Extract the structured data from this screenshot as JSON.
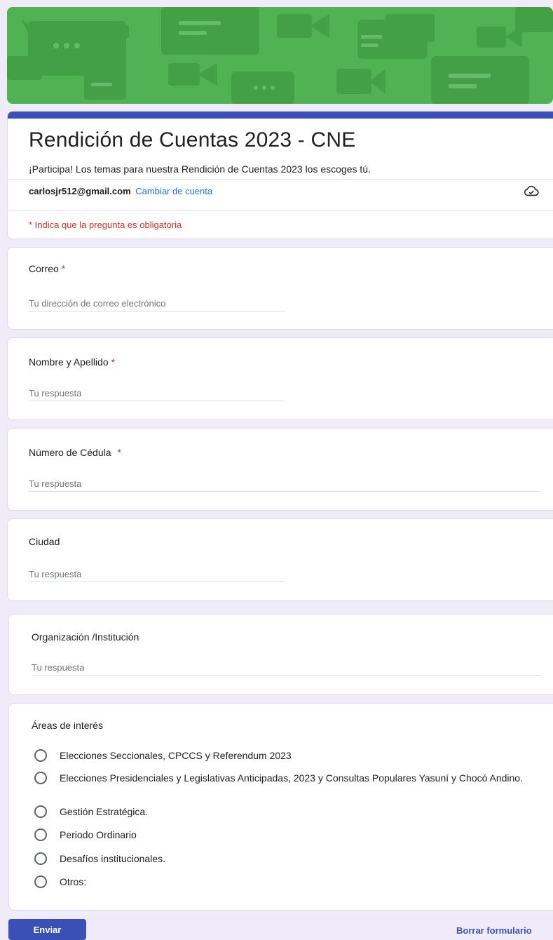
{
  "form": {
    "title": "Rendición de Cuentas 2023 - CNE",
    "description": "¡Participa! Los temas para nuestra Rendición de Cuentas 2023 los escoges tú.",
    "account_email": "carlosjr512@gmail.com",
    "switch_account": "Cambiar de cuenta",
    "required_note": "* Indica que la pregunta es obligatoria"
  },
  "questions": {
    "email": {
      "label": "Correo",
      "star": "*",
      "placeholder": "Tu dirección de correo electrónico"
    },
    "name": {
      "label": "Nombre y Apellido",
      "star": "*",
      "placeholder": "Tu respuesta"
    },
    "id_number": {
      "label": "Número de Cédula",
      "star": "*",
      "placeholder": "Tu respuesta"
    },
    "city": {
      "label": "Ciudad",
      "placeholder": "Tu respuesta"
    },
    "organization": {
      "label": "Organización /Institución",
      "placeholder": "Tu respuesta"
    },
    "areas": {
      "label": "Áreas de interés",
      "options": [
        "Elecciones Seccionales, CPCCS y Referendum 2023",
        "Elecciones Presidenciales y Legislativas Anticipadas, 2023 y Consultas Populares Yasuní y Chocó Andino.",
        "Gestión Estratégica.",
        "Periodo Ordinario",
        "Desafíos institucionales.",
        "Otros:"
      ]
    }
  },
  "actions": {
    "submit": "Enviar",
    "clear": "Borrar formulario"
  },
  "colors": {
    "accent": "#3b4fb8",
    "banner": "#4caf50",
    "required": "#d93025",
    "link": "#1a73e8"
  },
  "icons": {
    "cloud": "cloud-saved-icon"
  }
}
